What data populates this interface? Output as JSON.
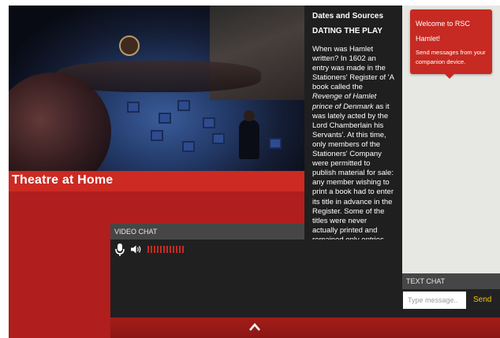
{
  "stage": {
    "title": "Theatre at Home"
  },
  "info": {
    "heading": "Dates and Sources",
    "subheading": "DATING THE PLAY",
    "body_1": "When was Hamlet written? In 1602 an entry was made in the Stationers' Register of 'A book called the ",
    "body_italic": "Revenge of Hamlet prince of Denmark",
    "body_2": " as it was lately acted by the Lord Chamberlain his Servants'. At this time, only members of the Stationers' Company were permitted to publish material for sale: any member wishing to print a book had to enter its title in advance in the Register. Some of the titles were never actually printed and remained only entries but the",
    "scroll_up_icon": "chevron-up-icon",
    "scroll_down_icon": "chevron-down-icon"
  },
  "notification": {
    "line1": "Welcome to RSC Hamlet!",
    "line2": "Send messages from your companion device."
  },
  "text_chat": {
    "label": "TEXT CHAT",
    "placeholder": "Type message..",
    "send_label": "Send"
  },
  "video_chat": {
    "label": "VIDEO CHAT",
    "mic_icon": "microphone-icon",
    "speaker_icon": "speaker-icon",
    "level_bars": 12,
    "level_color": "#c82a22"
  },
  "bottom_bar": {
    "expand_icon": "chevron-up-icon"
  },
  "colors": {
    "accent_red": "#cc2a22",
    "send_yellow": "#f0c400",
    "dark_panel": "#1f1f1f"
  }
}
